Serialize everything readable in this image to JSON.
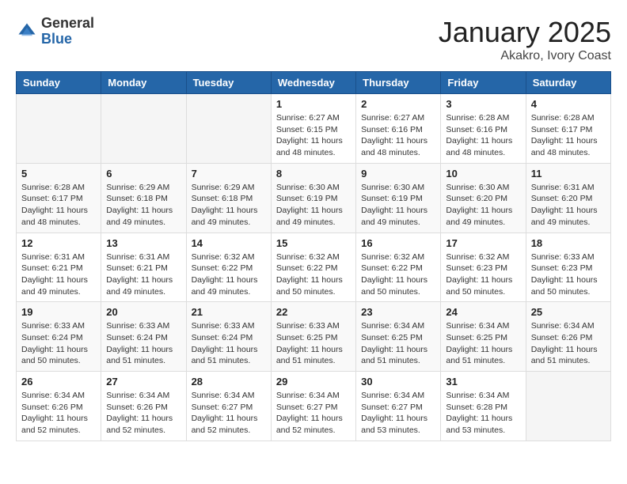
{
  "header": {
    "logo_general": "General",
    "logo_blue": "Blue",
    "month_title": "January 2025",
    "location": "Akakro, Ivory Coast"
  },
  "days_of_week": [
    "Sunday",
    "Monday",
    "Tuesday",
    "Wednesday",
    "Thursday",
    "Friday",
    "Saturday"
  ],
  "weeks": [
    [
      {
        "day": "",
        "info": ""
      },
      {
        "day": "",
        "info": ""
      },
      {
        "day": "",
        "info": ""
      },
      {
        "day": "1",
        "info": "Sunrise: 6:27 AM\nSunset: 6:15 PM\nDaylight: 11 hours\nand 48 minutes."
      },
      {
        "day": "2",
        "info": "Sunrise: 6:27 AM\nSunset: 6:16 PM\nDaylight: 11 hours\nand 48 minutes."
      },
      {
        "day": "3",
        "info": "Sunrise: 6:28 AM\nSunset: 6:16 PM\nDaylight: 11 hours\nand 48 minutes."
      },
      {
        "day": "4",
        "info": "Sunrise: 6:28 AM\nSunset: 6:17 PM\nDaylight: 11 hours\nand 48 minutes."
      }
    ],
    [
      {
        "day": "5",
        "info": "Sunrise: 6:28 AM\nSunset: 6:17 PM\nDaylight: 11 hours\nand 48 minutes."
      },
      {
        "day": "6",
        "info": "Sunrise: 6:29 AM\nSunset: 6:18 PM\nDaylight: 11 hours\nand 49 minutes."
      },
      {
        "day": "7",
        "info": "Sunrise: 6:29 AM\nSunset: 6:18 PM\nDaylight: 11 hours\nand 49 minutes."
      },
      {
        "day": "8",
        "info": "Sunrise: 6:30 AM\nSunset: 6:19 PM\nDaylight: 11 hours\nand 49 minutes."
      },
      {
        "day": "9",
        "info": "Sunrise: 6:30 AM\nSunset: 6:19 PM\nDaylight: 11 hours\nand 49 minutes."
      },
      {
        "day": "10",
        "info": "Sunrise: 6:30 AM\nSunset: 6:20 PM\nDaylight: 11 hours\nand 49 minutes."
      },
      {
        "day": "11",
        "info": "Sunrise: 6:31 AM\nSunset: 6:20 PM\nDaylight: 11 hours\nand 49 minutes."
      }
    ],
    [
      {
        "day": "12",
        "info": "Sunrise: 6:31 AM\nSunset: 6:21 PM\nDaylight: 11 hours\nand 49 minutes."
      },
      {
        "day": "13",
        "info": "Sunrise: 6:31 AM\nSunset: 6:21 PM\nDaylight: 11 hours\nand 49 minutes."
      },
      {
        "day": "14",
        "info": "Sunrise: 6:32 AM\nSunset: 6:22 PM\nDaylight: 11 hours\nand 49 minutes."
      },
      {
        "day": "15",
        "info": "Sunrise: 6:32 AM\nSunset: 6:22 PM\nDaylight: 11 hours\nand 50 minutes."
      },
      {
        "day": "16",
        "info": "Sunrise: 6:32 AM\nSunset: 6:22 PM\nDaylight: 11 hours\nand 50 minutes."
      },
      {
        "day": "17",
        "info": "Sunrise: 6:32 AM\nSunset: 6:23 PM\nDaylight: 11 hours\nand 50 minutes."
      },
      {
        "day": "18",
        "info": "Sunrise: 6:33 AM\nSunset: 6:23 PM\nDaylight: 11 hours\nand 50 minutes."
      }
    ],
    [
      {
        "day": "19",
        "info": "Sunrise: 6:33 AM\nSunset: 6:24 PM\nDaylight: 11 hours\nand 50 minutes."
      },
      {
        "day": "20",
        "info": "Sunrise: 6:33 AM\nSunset: 6:24 PM\nDaylight: 11 hours\nand 51 minutes."
      },
      {
        "day": "21",
        "info": "Sunrise: 6:33 AM\nSunset: 6:24 PM\nDaylight: 11 hours\nand 51 minutes."
      },
      {
        "day": "22",
        "info": "Sunrise: 6:33 AM\nSunset: 6:25 PM\nDaylight: 11 hours\nand 51 minutes."
      },
      {
        "day": "23",
        "info": "Sunrise: 6:34 AM\nSunset: 6:25 PM\nDaylight: 11 hours\nand 51 minutes."
      },
      {
        "day": "24",
        "info": "Sunrise: 6:34 AM\nSunset: 6:25 PM\nDaylight: 11 hours\nand 51 minutes."
      },
      {
        "day": "25",
        "info": "Sunrise: 6:34 AM\nSunset: 6:26 PM\nDaylight: 11 hours\nand 51 minutes."
      }
    ],
    [
      {
        "day": "26",
        "info": "Sunrise: 6:34 AM\nSunset: 6:26 PM\nDaylight: 11 hours\nand 52 minutes."
      },
      {
        "day": "27",
        "info": "Sunrise: 6:34 AM\nSunset: 6:26 PM\nDaylight: 11 hours\nand 52 minutes."
      },
      {
        "day": "28",
        "info": "Sunrise: 6:34 AM\nSunset: 6:27 PM\nDaylight: 11 hours\nand 52 minutes."
      },
      {
        "day": "29",
        "info": "Sunrise: 6:34 AM\nSunset: 6:27 PM\nDaylight: 11 hours\nand 52 minutes."
      },
      {
        "day": "30",
        "info": "Sunrise: 6:34 AM\nSunset: 6:27 PM\nDaylight: 11 hours\nand 53 minutes."
      },
      {
        "day": "31",
        "info": "Sunrise: 6:34 AM\nSunset: 6:28 PM\nDaylight: 11 hours\nand 53 minutes."
      },
      {
        "day": "",
        "info": ""
      }
    ]
  ]
}
